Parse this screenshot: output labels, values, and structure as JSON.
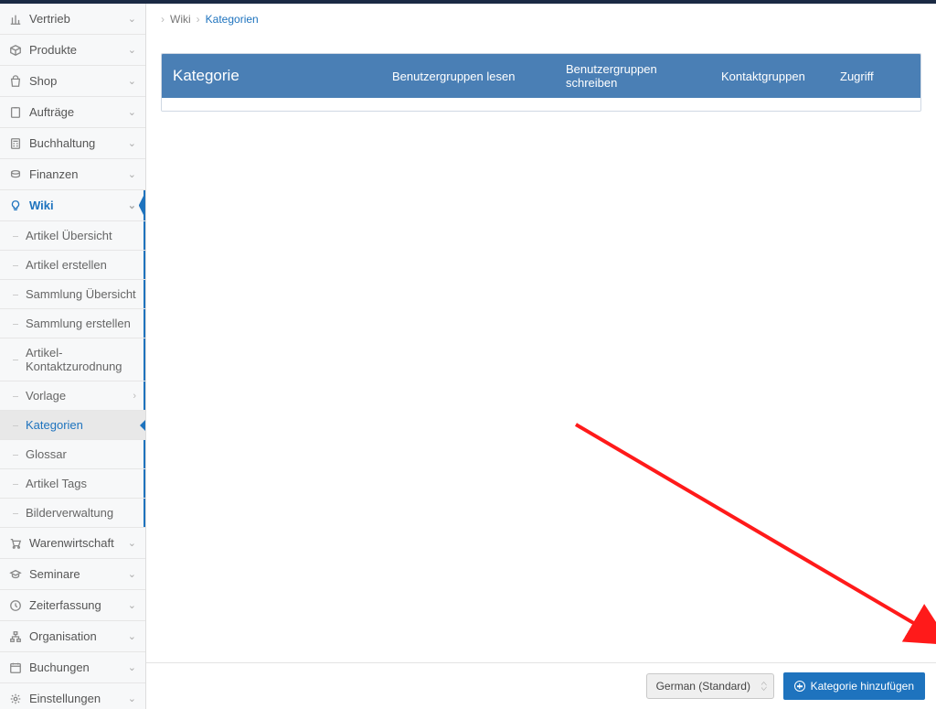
{
  "sidebar": {
    "vertrieb": "Vertrieb",
    "produkte": "Produkte",
    "shop": "Shop",
    "auftraege": "Aufträge",
    "buchhaltung": "Buchhaltung",
    "finanzen": "Finanzen",
    "wiki": "Wiki",
    "wiki_sub": {
      "artikel_uebersicht": "Artikel Übersicht",
      "artikel_erstellen": "Artikel erstellen",
      "sammlung_uebersicht": "Sammlung Übersicht",
      "sammlung_erstellen": "Sammlung erstellen",
      "artikel_kontaktzuordnung": "Artikel-Kontaktzurodnung",
      "vorlage": "Vorlage",
      "kategorien": "Kategorien",
      "glossar": "Glossar",
      "artikel_tags": "Artikel Tags",
      "bilderverwaltung": "Bilderverwaltung"
    },
    "warenwirtschaft": "Warenwirtschaft",
    "seminare": "Seminare",
    "zeiterfassung": "Zeiterfassung",
    "organisation": "Organisation",
    "buchungen": "Buchungen",
    "einstellungen": "Einstellungen"
  },
  "breadcrumb": {
    "wiki": "Wiki",
    "kategorien": "Kategorien"
  },
  "table": {
    "headers": {
      "kategorie": "Kategorie",
      "benutzergruppen_lesen": "Benutzergruppen lesen",
      "benutzergruppen_schreiben": "Benutzergruppen schreiben",
      "kontaktgruppen": "Kontaktgruppen",
      "zugriff": "Zugriff"
    }
  },
  "footer": {
    "language_selected": "German (Standard)",
    "add_button": "Kategorie hinzufügen"
  }
}
